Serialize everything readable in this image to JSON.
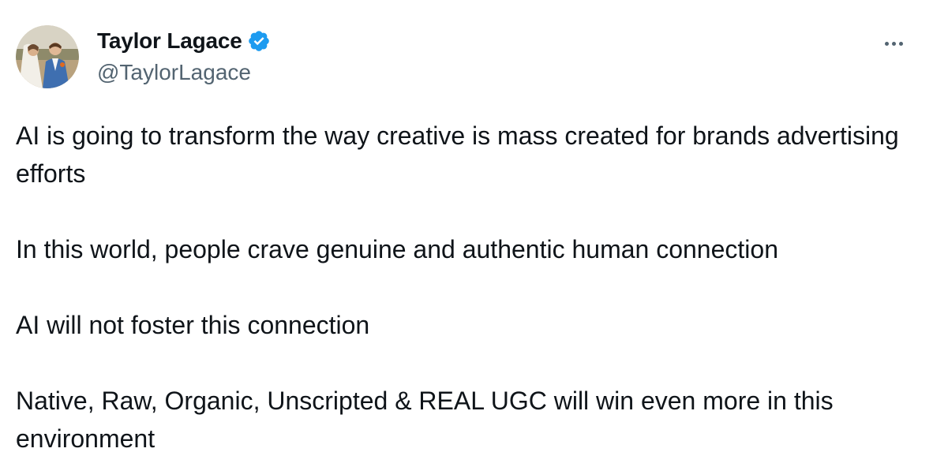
{
  "author": {
    "display_name": "Taylor Lagace",
    "handle": "@TaylorLagace",
    "verified": true,
    "verified_color": "#1d9bf0"
  },
  "menu": {
    "icon": "more-horizontal-icon"
  },
  "tweet": {
    "paragraphs": [
      "AI is going to transform the way creative is mass created for brands advertising efforts",
      "In this world, people crave genuine and authentic human connection",
      "AI will not foster this connection",
      "Native, Raw, Organic, Unscripted & REAL UGC will win even more in this environment"
    ]
  },
  "colors": {
    "text_primary": "#0f1419",
    "text_secondary": "#536471",
    "background": "#ffffff"
  }
}
